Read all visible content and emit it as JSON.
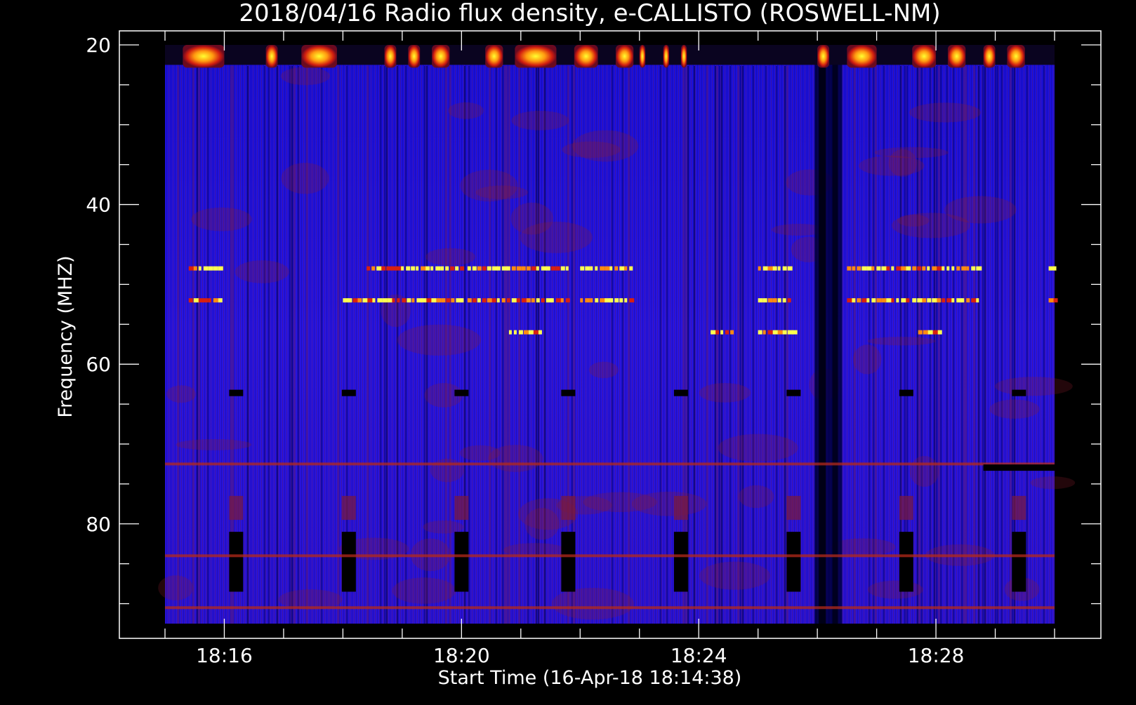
{
  "chart_data": {
    "type": "heatmap",
    "title": "2018/04/16  Radio flux density, e-CALLISTO (ROSWELL-NM)",
    "xlabel": "Start Time (16-Apr-18 18:14:38)",
    "ylabel": "Frequency (MHZ)",
    "x_tick_labels": [
      "18:16",
      "18:20",
      "18:24",
      "18:28"
    ],
    "x_tick_minutes": [
      16,
      20,
      24,
      28
    ],
    "y_ticks": [
      20,
      40,
      60,
      80
    ],
    "y_range": [
      20,
      92.5
    ],
    "x_range_minutes": [
      15.0,
      30.0
    ],
    "y_axis_inverted": true,
    "colormap": [
      "#000000",
      "#00008f",
      "#1a10e8",
      "#8b1a1a",
      "#d0301a",
      "#ff9000",
      "#ffff30"
    ],
    "features": {
      "low_freq_band": {
        "freq_range": [
          20,
          22.5
        ],
        "bright_spans_min": [
          [
            15.3,
            16.0
          ],
          [
            16.7,
            16.9
          ],
          [
            17.3,
            17.9
          ],
          [
            18.7,
            18.9
          ],
          [
            19.1,
            19.3
          ],
          [
            19.5,
            19.8
          ],
          [
            20.4,
            20.7
          ],
          [
            20.9,
            21.6
          ],
          [
            21.9,
            22.3
          ],
          [
            22.6,
            22.9
          ],
          [
            23.0,
            23.1
          ],
          [
            23.4,
            23.5
          ],
          [
            23.7,
            23.8
          ],
          [
            26.0,
            26.2
          ],
          [
            26.5,
            27.0
          ],
          [
            27.6,
            28.0
          ],
          [
            28.2,
            28.5
          ],
          [
            28.8,
            29.0
          ],
          [
            29.2,
            29.5
          ]
        ]
      },
      "narrowband_lines": [
        {
          "freq": 48,
          "spans_min": [
            [
              15.4,
              15.9
            ],
            [
              18.4,
              20.0
            ],
            [
              20.1,
              21.8
            ],
            [
              22.0,
              22.9
            ],
            [
              25.0,
              25.5
            ],
            [
              26.5,
              27.5
            ],
            [
              27.6,
              28.7
            ],
            [
              29.9,
              30.0
            ]
          ]
        },
        {
          "freq": 52,
          "spans_min": [
            [
              15.4,
              15.9
            ],
            [
              18.0,
              20.0
            ],
            [
              20.1,
              21.8
            ],
            [
              22.0,
              22.9
            ],
            [
              25.0,
              25.5
            ],
            [
              26.5,
              27.5
            ],
            [
              27.6,
              28.7
            ],
            [
              29.9,
              30.0
            ]
          ]
        },
        {
          "freq": 56,
          "spans_min": [
            [
              20.8,
              21.3
            ],
            [
              24.2,
              24.6
            ],
            [
              25.0,
              25.6
            ],
            [
              27.7,
              28.1
            ]
          ]
        },
        {
          "freq": 72.5,
          "spans_min": [
            [
              15.0,
              30.0
            ]
          ]
        },
        {
          "freq": 84,
          "spans_min": [
            [
              15.0,
              30.0
            ]
          ]
        },
        {
          "freq": 90.5,
          "spans_min": [
            [
              15.0,
              30.0
            ]
          ]
        }
      ],
      "calibration_gaps_min": [
        16.2,
        18.1,
        20.0,
        21.8,
        23.7,
        25.6,
        27.5,
        29.4
      ],
      "dropout_min": [
        26.0,
        26.3
      ],
      "dark_strip": {
        "freq": 73,
        "span_min": [
          28.8,
          30.0
        ]
      }
    }
  }
}
